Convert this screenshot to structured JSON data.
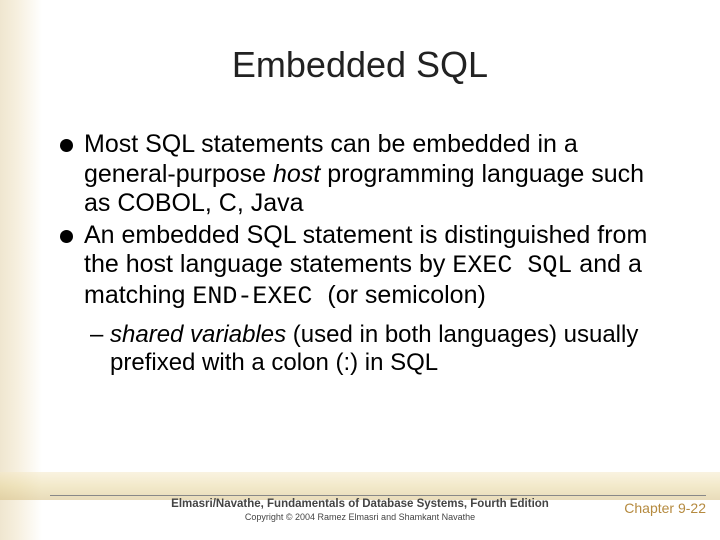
{
  "title": "Embedded SQL",
  "bullets": [
    {
      "pre": "Most SQL statements can be embedded in a general-purpose ",
      "em1": "host",
      "post": " programming language such as COBOL, C, Java"
    },
    {
      "pre": "An embedded SQL statement is distinguished from the host language statements by ",
      "code1": "EXEC SQL",
      "mid": " and a matching ",
      "code2": "END-EXEC ",
      "post": " (or semicolon)"
    }
  ],
  "sub": {
    "dash": "–",
    "em": "shared variables",
    "rest": " (used in both languages) usually prefixed with a colon (:) in SQL"
  },
  "footer": {
    "line1": "Elmasri/Navathe, Fundamentals of Database Systems, Fourth Edition",
    "line2": "Copyright © 2004 Ramez Elmasri and Shamkant Navathe"
  },
  "pagenum": "Chapter 9-22"
}
